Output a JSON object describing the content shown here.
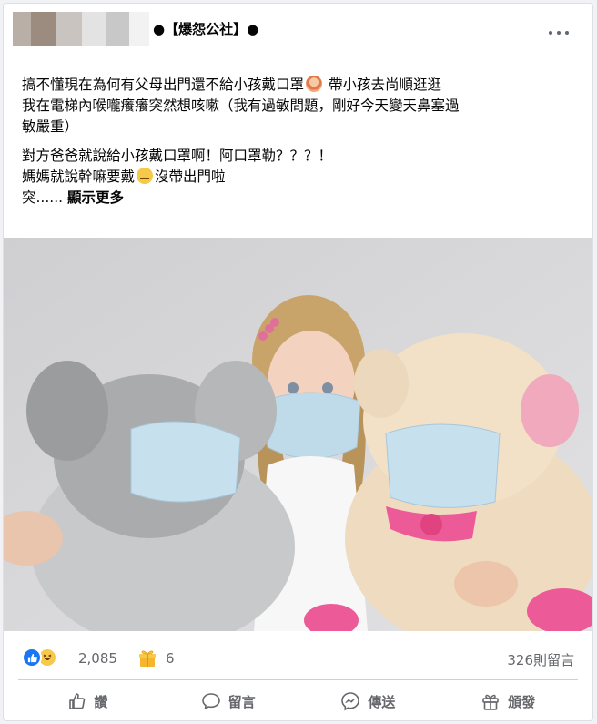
{
  "header": {
    "group_name": "●【爆怨公社】●",
    "avatar_blocks": [
      "#b9afa7",
      "#9c8c80",
      "#c9c4c0",
      "#e3e3e3",
      "#c8c8c8",
      "#f2f2f2"
    ],
    "more_icon": "ellipsis-icon"
  },
  "post": {
    "line1": "搞不懂現在為何有父母出門還不給小孩戴口罩",
    "line1b": "帶小孩去尚順逛逛",
    "line2": "我在電梯內喉嚨癢癢突然想咳嗽（我有過敏問題，剛好今天變天鼻塞過",
    "line3": "敏嚴重）",
    "line4": "對方爸爸就說給小孩戴口罩啊！阿口罩勒？？？！",
    "line5a": "媽媽就說幹嘛要戴",
    "line5b": "沒帶出門啦",
    "line6": "突......",
    "see_more": "顯示更多"
  },
  "stats": {
    "reaction_count": "2,085",
    "award_count": "6",
    "comment_count": "326則留言"
  },
  "actions": {
    "like": "讚",
    "comment": "留言",
    "share": "傳送",
    "award": "頒發"
  },
  "colors": {
    "accent": "#1877f2",
    "muted_text": "#65676b",
    "divider": "#ced0d4"
  }
}
